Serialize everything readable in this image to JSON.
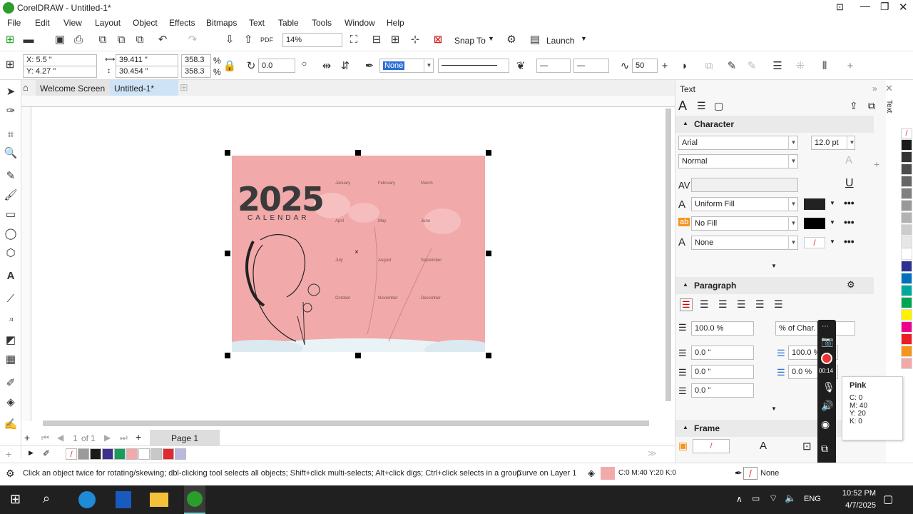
{
  "title": "CorelDRAW - Untitled-1*",
  "menu": [
    "File",
    "Edit",
    "View",
    "Layout",
    "Object",
    "Effects",
    "Bitmaps",
    "Text",
    "Table",
    "Tools",
    "Window",
    "Help"
  ],
  "toolbar": {
    "zoom": "14%",
    "snap": "Snap To",
    "launch": "Launch"
  },
  "props": {
    "x": "X: 5.5 \"",
    "y": "Y: 4.27 \"",
    "w": "39.411 \"",
    "h": "30.454 \"",
    "sx": "358.3",
    "sy": "358.3",
    "pct": "%",
    "angle": "0.0",
    "outline": "None",
    "smooth": "50"
  },
  "tabs": {
    "welcome": "Welcome Screen",
    "doc": "Untitled-1*"
  },
  "page_nav": {
    "count": "1",
    "of": "of",
    "total": "1",
    "label": "Page 1"
  },
  "artwork": {
    "year": "2025",
    "subtitle": "CALENDAR",
    "months": [
      "January",
      "February",
      "March",
      "April",
      "May",
      "June",
      "July",
      "August",
      "September",
      "October",
      "November",
      "December"
    ]
  },
  "status": {
    "hint": "Click an object twice for rotating/skewing; dbl-clicking tool selects all objects; Shift+click multi-selects; Alt+click digs; Ctrl+click selects in a group",
    "object": "Curve on Layer 1",
    "fill": "C:0 M:40 Y:20 K:0",
    "outline": "None"
  },
  "docker": {
    "title": "Text",
    "character": "Character",
    "font": "Arial",
    "size": "12.0 pt",
    "style": "Normal",
    "fill1": "Uniform Fill",
    "fill2": "No Fill",
    "fill3": "None",
    "paragraph": "Paragraph",
    "line_spacing": "100.0 %",
    "spacing_unit": "% of Char. H",
    "indent1": "0.0 \"",
    "indent2": "0.0 \"",
    "indent3": "0.0 \"",
    "char_spacing": "100.0 %",
    "word_spacing": "0.0 %",
    "frame": "Frame",
    "vertical_label": "Text"
  },
  "tooltip": {
    "name": "Pink",
    "c": "C: 0",
    "m": "M: 40",
    "y": "Y: 20",
    "k": "K: 0"
  },
  "recorder": {
    "time": "00:14"
  },
  "taskbar": {
    "lang": "ENG",
    "time": "10:52 PM",
    "date": "4/7/2025"
  },
  "colors": {
    "pink": "#f2a9aa",
    "accent": "#1e9e1e",
    "selected_tab": "#cfe3f7"
  },
  "palette_doc": [
    "#ffffff",
    "#9b9b9b",
    "#1a1a1a",
    "#3f2f8f",
    "#1a9c5a",
    "#f2a9aa",
    "#ffffff",
    "#c8c8c8",
    "#e3282e",
    "#b9b9e0"
  ],
  "palette_side": [
    "#1a1a1a",
    "#333333",
    "#4d4d4d",
    "#666666",
    "#808080",
    "#999999",
    "#b3b3b3",
    "#cccccc",
    "#e6e6e6",
    "#ffffff",
    "#2e3192",
    "#0072bc",
    "#00a99d",
    "#00a651",
    "#fff200",
    "#ec008c",
    "#ed1c24",
    "#f7941d",
    "#f2a9aa"
  ]
}
